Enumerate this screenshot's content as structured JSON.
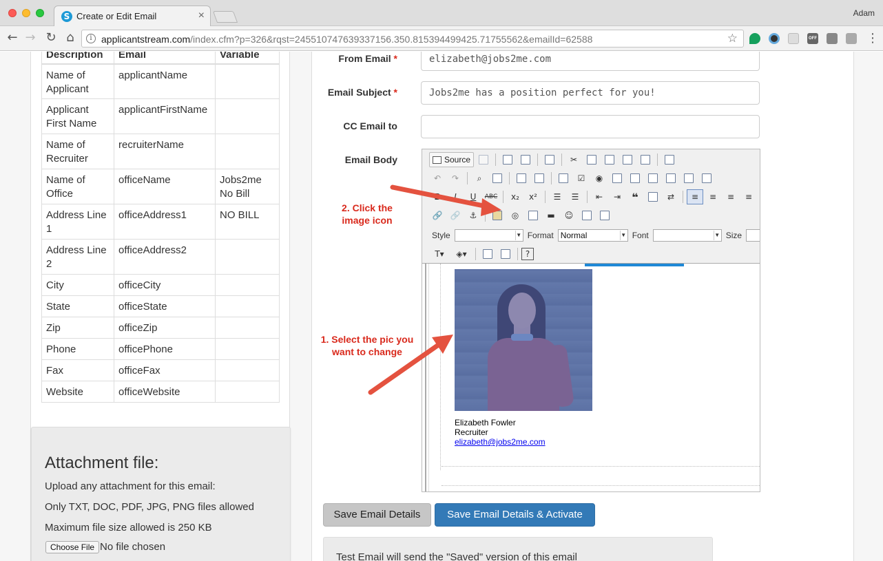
{
  "browser": {
    "tab_title": "Create or Edit Email",
    "profile_name": "Adam",
    "url_host": "applicantstream.com",
    "url_path": "/index.cfm?p=326&rqst=245510747639337156.350.815394499425.71755562&emailId=62588"
  },
  "variables_table": {
    "headers": [
      "Description",
      "Email",
      "Variable"
    ],
    "rows": [
      {
        "description": "Name of Applicant",
        "email": "applicantName",
        "variable": ""
      },
      {
        "description": "Applicant First Name",
        "email": "applicantFirstName",
        "variable": ""
      },
      {
        "description": "Name of Recruiter",
        "email": "recruiterName",
        "variable": ""
      },
      {
        "description": "Name of Office",
        "email": "officeName",
        "variable": "Jobs2me No Bill"
      },
      {
        "description": "Address Line 1",
        "email": "officeAddress1",
        "variable": "NO BILL"
      },
      {
        "description": "Address Line 2",
        "email": "officeAddress2",
        "variable": ""
      },
      {
        "description": "City",
        "email": "officeCity",
        "variable": ""
      },
      {
        "description": "State",
        "email": "officeState",
        "variable": ""
      },
      {
        "description": "Zip",
        "email": "officeZip",
        "variable": ""
      },
      {
        "description": "Phone",
        "email": "officePhone",
        "variable": ""
      },
      {
        "description": "Fax",
        "email": "officeFax",
        "variable": ""
      },
      {
        "description": "Website",
        "email": "officeWebsite",
        "variable": ""
      }
    ]
  },
  "attachment": {
    "title": "Attachment file:",
    "line1": "Upload any attachment for this email:",
    "line2": "Only TXT, DOC, PDF, JPG, PNG files allowed",
    "line3": "Maximum file size allowed is 250 KB",
    "choose_label": "Choose File",
    "no_file_label": "No file chosen"
  },
  "form": {
    "from_label": "From Email",
    "from_value": "elizabeth@jobs2me.com",
    "subject_label": "Email Subject",
    "subject_value": "Jobs2me has a position perfect for you!",
    "cc_label": "CC Email to",
    "cc_value": "",
    "body_label": "Email Body",
    "required_mark": "*"
  },
  "editor": {
    "source_label": "Source",
    "style_label": "Style",
    "style_value": "",
    "format_label": "Format",
    "format_value": "Normal",
    "font_label": "Font",
    "font_value": "",
    "size_label": "Size",
    "signature": {
      "name": "Elizabeth Fowler",
      "title": "Recruiter",
      "email": "elizabeth@jobs2me.com"
    }
  },
  "buttons": {
    "save": "Save Email Details",
    "save_activate": "Save Email Details & Activate"
  },
  "test_email_text": "Test Email will send the \"Saved\" version of this email",
  "annotations": {
    "step1": "1.  Select the pic you want to change",
    "step2": "2.  Click the image icon",
    "color": "#d9291c"
  },
  "colors": {
    "primary_button": "#337ab7",
    "default_button": "#c6c6c6",
    "required": "#d9291c"
  }
}
